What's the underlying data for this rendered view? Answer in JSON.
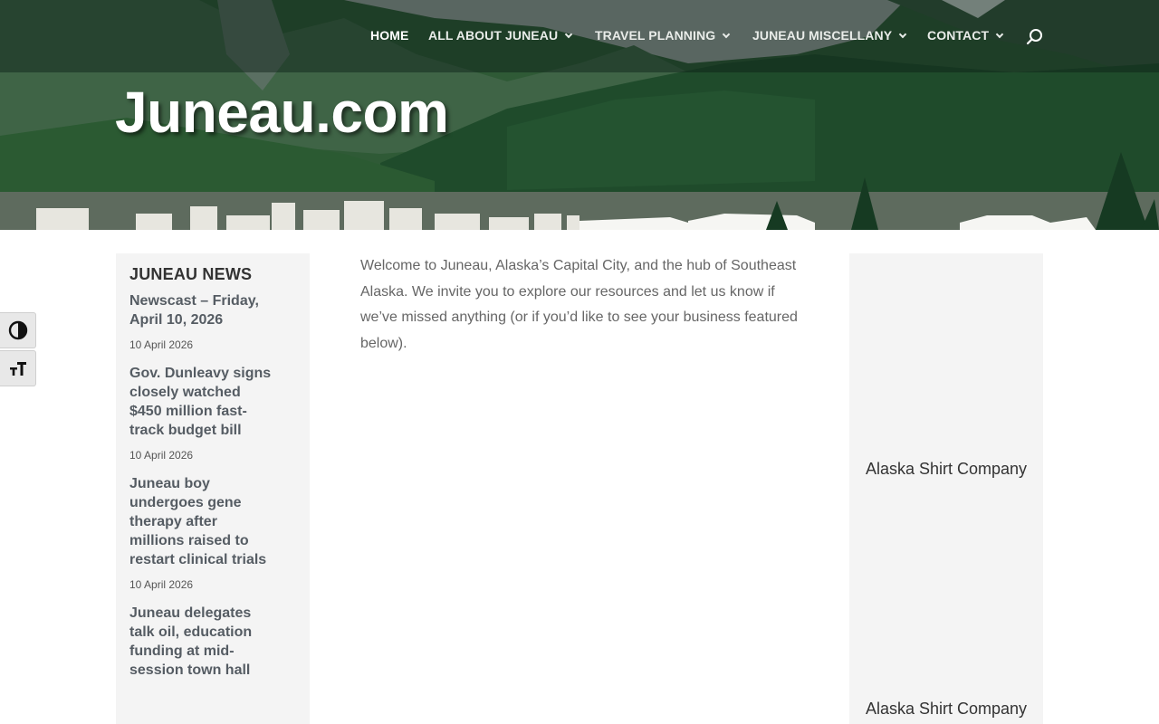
{
  "site": {
    "title": "Juneau.com"
  },
  "nav": {
    "items": [
      {
        "label": "HOME",
        "has_dropdown": false,
        "active": true
      },
      {
        "label": "ALL ABOUT JUNEAU",
        "has_dropdown": true
      },
      {
        "label": "TRAVEL PLANNING",
        "has_dropdown": true
      },
      {
        "label": "JUNEAU MISCELLANY",
        "has_dropdown": true
      },
      {
        "label": "CONTACT",
        "has_dropdown": true
      }
    ],
    "search_icon": "search-icon"
  },
  "accessibility": {
    "contrast_icon": "contrast-icon",
    "font_size_icon": "font-resize-icon"
  },
  "news": {
    "heading": "JUNEAU NEWS",
    "items": [
      {
        "title": "Newscast – Friday, April 10, 2026",
        "date": "10 April 2026"
      },
      {
        "title": "Gov. Dunleavy signs closely watched $450 million fast-track budget bill",
        "date": "10 April 2026"
      },
      {
        "title": "Juneau boy undergoes gene therapy after millions raised to restart clinical trials",
        "date": "10 April 2026"
      },
      {
        "title": "Juneau delegates talk oil, education funding at mid-session town hall",
        "date": ""
      }
    ]
  },
  "main": {
    "intro": "Welcome to Juneau, Alaska’s Capital City, and the hub of Southeast Alaska. We invite you to explore our resources and let us know if we’ve missed anything (or if you’d like to see your business featured below)."
  },
  "sidebar": {
    "ads": [
      {
        "label": "Alaska Shirt Company"
      },
      {
        "label": "Alaska Shirt Company"
      }
    ]
  },
  "colors": {
    "nav_text": "#e9ece9",
    "panel_bg": "#f4f4f4",
    "news_link": "#555c63",
    "body_text": "#666666"
  }
}
